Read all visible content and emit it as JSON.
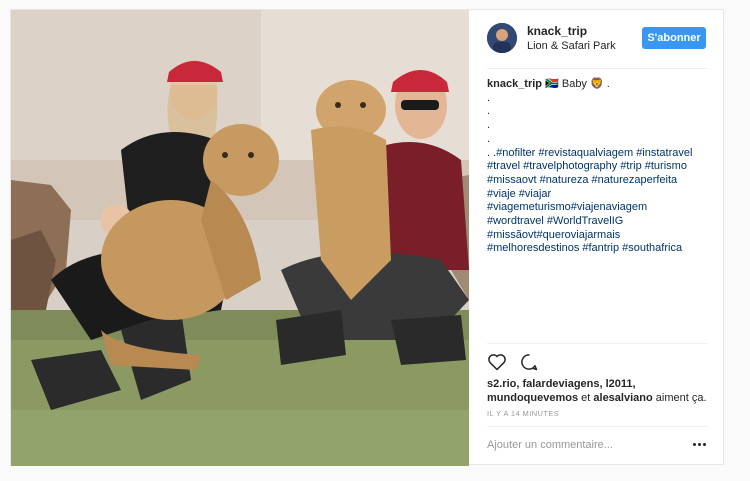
{
  "post": {
    "username": "knack_trip",
    "location": "Lion & Safari Park",
    "follow_label": "S'abonner",
    "caption": {
      "author": "knack_trip",
      "flag": "🇿🇦",
      "text": "Baby",
      "emoji": "🦁",
      "trailing": ".",
      "dots": [
        ".",
        ".",
        ".",
        ".",
        ". ."
      ],
      "hashtag_lines": [
        "#nofilter #revistaqualviagem #instatravel",
        "#travel #travelphotography #trip #turismo",
        "#missaovt #natureza #naturezaperfeita",
        "#viaje #viajar",
        "#viagemeturismo#viajenaviagem",
        "#wordtravel #WorldTravelIG",
        "#missãovt#queroviajarmais",
        "#melhoresdestinos #fantrip #southafrica"
      ]
    },
    "likes": {
      "line1": "s2.rio, falardeviagens, l2011,",
      "line2_names": "mundoquevemos",
      "line2_and": "et",
      "line2_last": "alesalviano",
      "line2_suffix": "aiment ça."
    },
    "timestamp": "IL Y A 14 MINUTES",
    "comment_placeholder": "Ajouter un commentaire..."
  },
  "colors": {
    "accent": "#3897f0",
    "hashtag": "#003569",
    "text": "#262626",
    "muted": "#999999"
  },
  "icons": {
    "like": "heart-icon",
    "comment": "comment-bubble-icon",
    "more": "more-options-icon"
  }
}
